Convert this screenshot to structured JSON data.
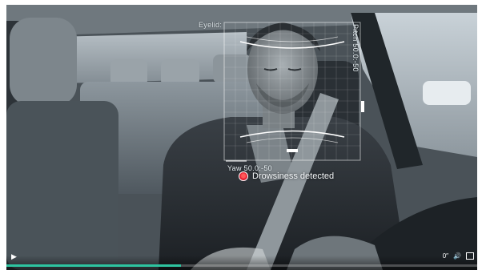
{
  "hud": {
    "eyelid_label": "Eyelid:",
    "pitch_label": "Pitch 50.0:-50",
    "yaw_label": "Yaw 50.0:-50",
    "alert_text": "Drowsiness detected",
    "alert_color": "#d9001b",
    "grid_color": "#ffffff"
  },
  "player": {
    "progress": 0.37,
    "time_text": "0″",
    "play_icon": "play-icon",
    "volume_icon": "volume-icon",
    "fullscreen_icon": "fullscreen-icon",
    "accent_color": "#2ec4a0"
  }
}
